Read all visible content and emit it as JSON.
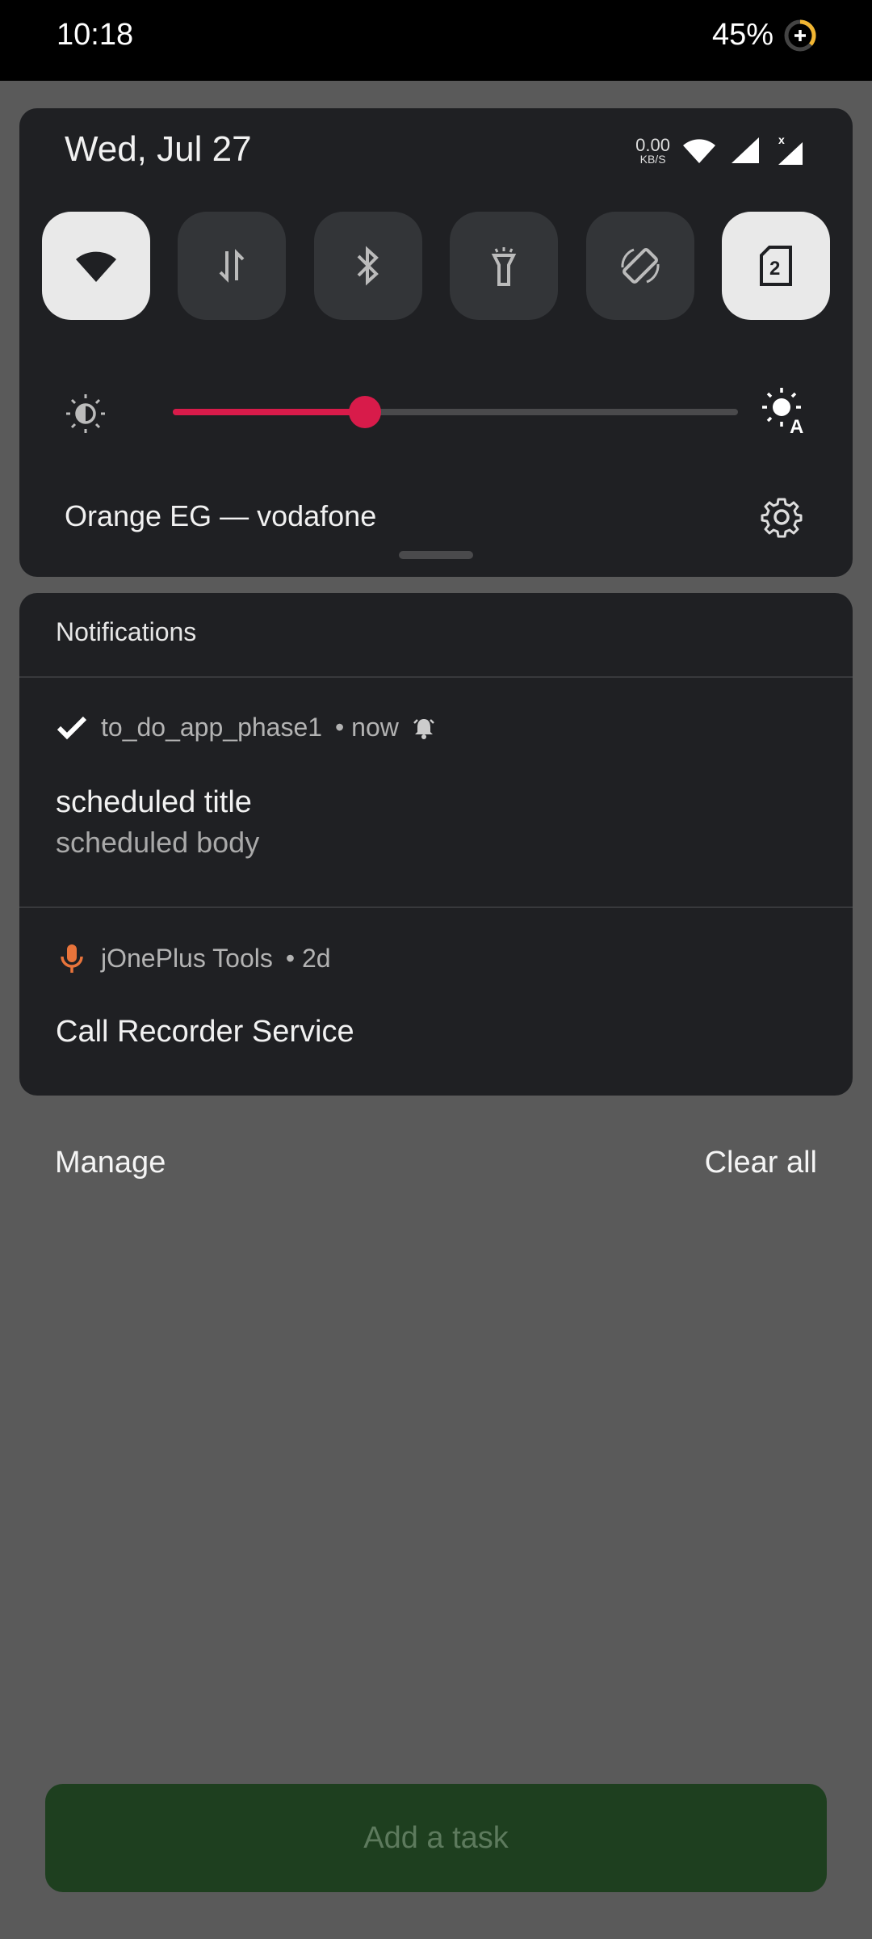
{
  "statusbar": {
    "time": "10:18",
    "battery": "45%"
  },
  "quick_settings": {
    "date": "Wed, Jul 27",
    "netspeed": {
      "value": "0.00",
      "unit": "KB/S"
    },
    "tiles": [
      {
        "name": "wifi",
        "icon": "wifi-icon",
        "active": true
      },
      {
        "name": "mobile-data",
        "icon": "data-arrows-icon",
        "active": false
      },
      {
        "name": "bluetooth",
        "icon": "bluetooth-icon",
        "active": false
      },
      {
        "name": "flashlight",
        "icon": "flashlight-icon",
        "active": false
      },
      {
        "name": "auto-rotate",
        "icon": "rotate-icon",
        "active": false
      },
      {
        "name": "sim-2",
        "icon": "sim-2-icon",
        "label": "2",
        "active": true
      }
    ],
    "brightness_level": 0.34,
    "carrier": "Orange EG — vodafone"
  },
  "notifications": {
    "header": "Notifications",
    "items": [
      {
        "app": "to_do_app_phase1",
        "time": "• now",
        "icon": "check-icon",
        "title": "scheduled title",
        "body": "scheduled body"
      },
      {
        "app": "jOnePlus Tools",
        "time": "• 2d",
        "icon": "mic-icon",
        "title": "Call Recorder Service"
      }
    ]
  },
  "actions": {
    "manage": "Manage",
    "clear_all": "Clear all"
  },
  "app": {
    "add_task": "Add a task"
  },
  "colors": {
    "accent": "#d81b4a",
    "panel": "#1f2023",
    "add_task_bg": "#1e3f1f"
  }
}
